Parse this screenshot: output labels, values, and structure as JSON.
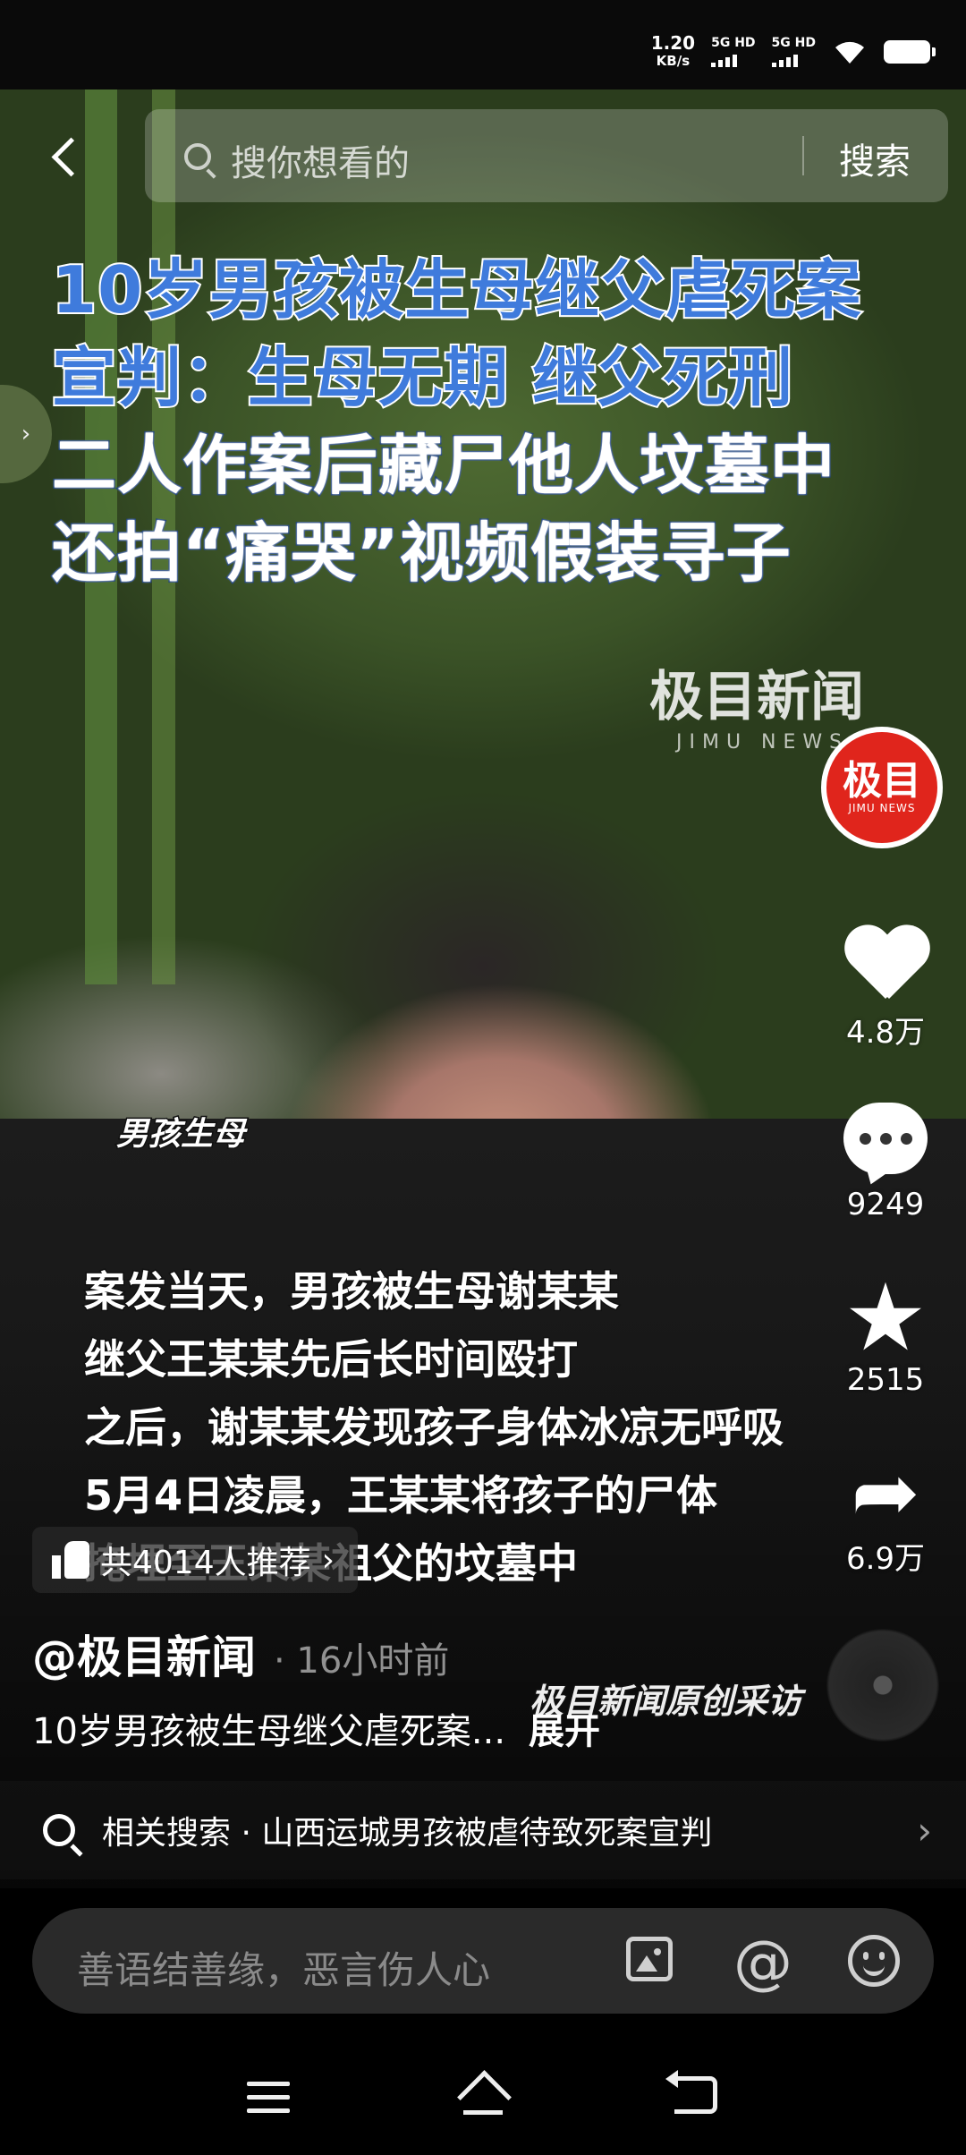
{
  "status_bar": {
    "speed_top": "1.20",
    "speed_unit": "KB/s",
    "signal1": "5G HD",
    "signal2": "5G HD"
  },
  "search": {
    "placeholder": "搜你想看的",
    "button": "搜索"
  },
  "headline": {
    "line1": "10岁男孩被生母继父虐死案",
    "line2": "宣判：生母无期 继父死刑",
    "line3": "二人作案后藏尸他人坟墓中",
    "line4": "还拍“痛哭”视频假装寻子"
  },
  "watermark": {
    "logo": "极目新闻",
    "sub": "JIMU NEWS"
  },
  "avatar": {
    "text": "极目",
    "sub": "JIMU NEWS"
  },
  "actions": {
    "likes": "4.8万",
    "comments": "9249",
    "favorites": "2515",
    "shares": "6.9万"
  },
  "captions": {
    "speaker": "男孩生母",
    "lines": [
      "案发当天，男孩被生母谢某某",
      "继父王某某先后长时间殴打",
      "之后，谢某某发现孩子身体冰凉无呼吸",
      "5月4日凌晨，王某某将孩子的尸体",
      "掩埋至王某某祖父的坟墓中"
    ],
    "credit": "极目新闻原创采访"
  },
  "recommend": {
    "label": "共4014人推荐"
  },
  "post": {
    "author": "@极目新闻",
    "time": "· 16小时前",
    "description": "10岁男孩被生母继父虐死案...",
    "expand": "展开"
  },
  "related": {
    "text": "相关搜索 · 山西运城男孩被虐待致死案宣判"
  },
  "comment_box": {
    "placeholder": "善语结善缘，恶言伤人心"
  }
}
